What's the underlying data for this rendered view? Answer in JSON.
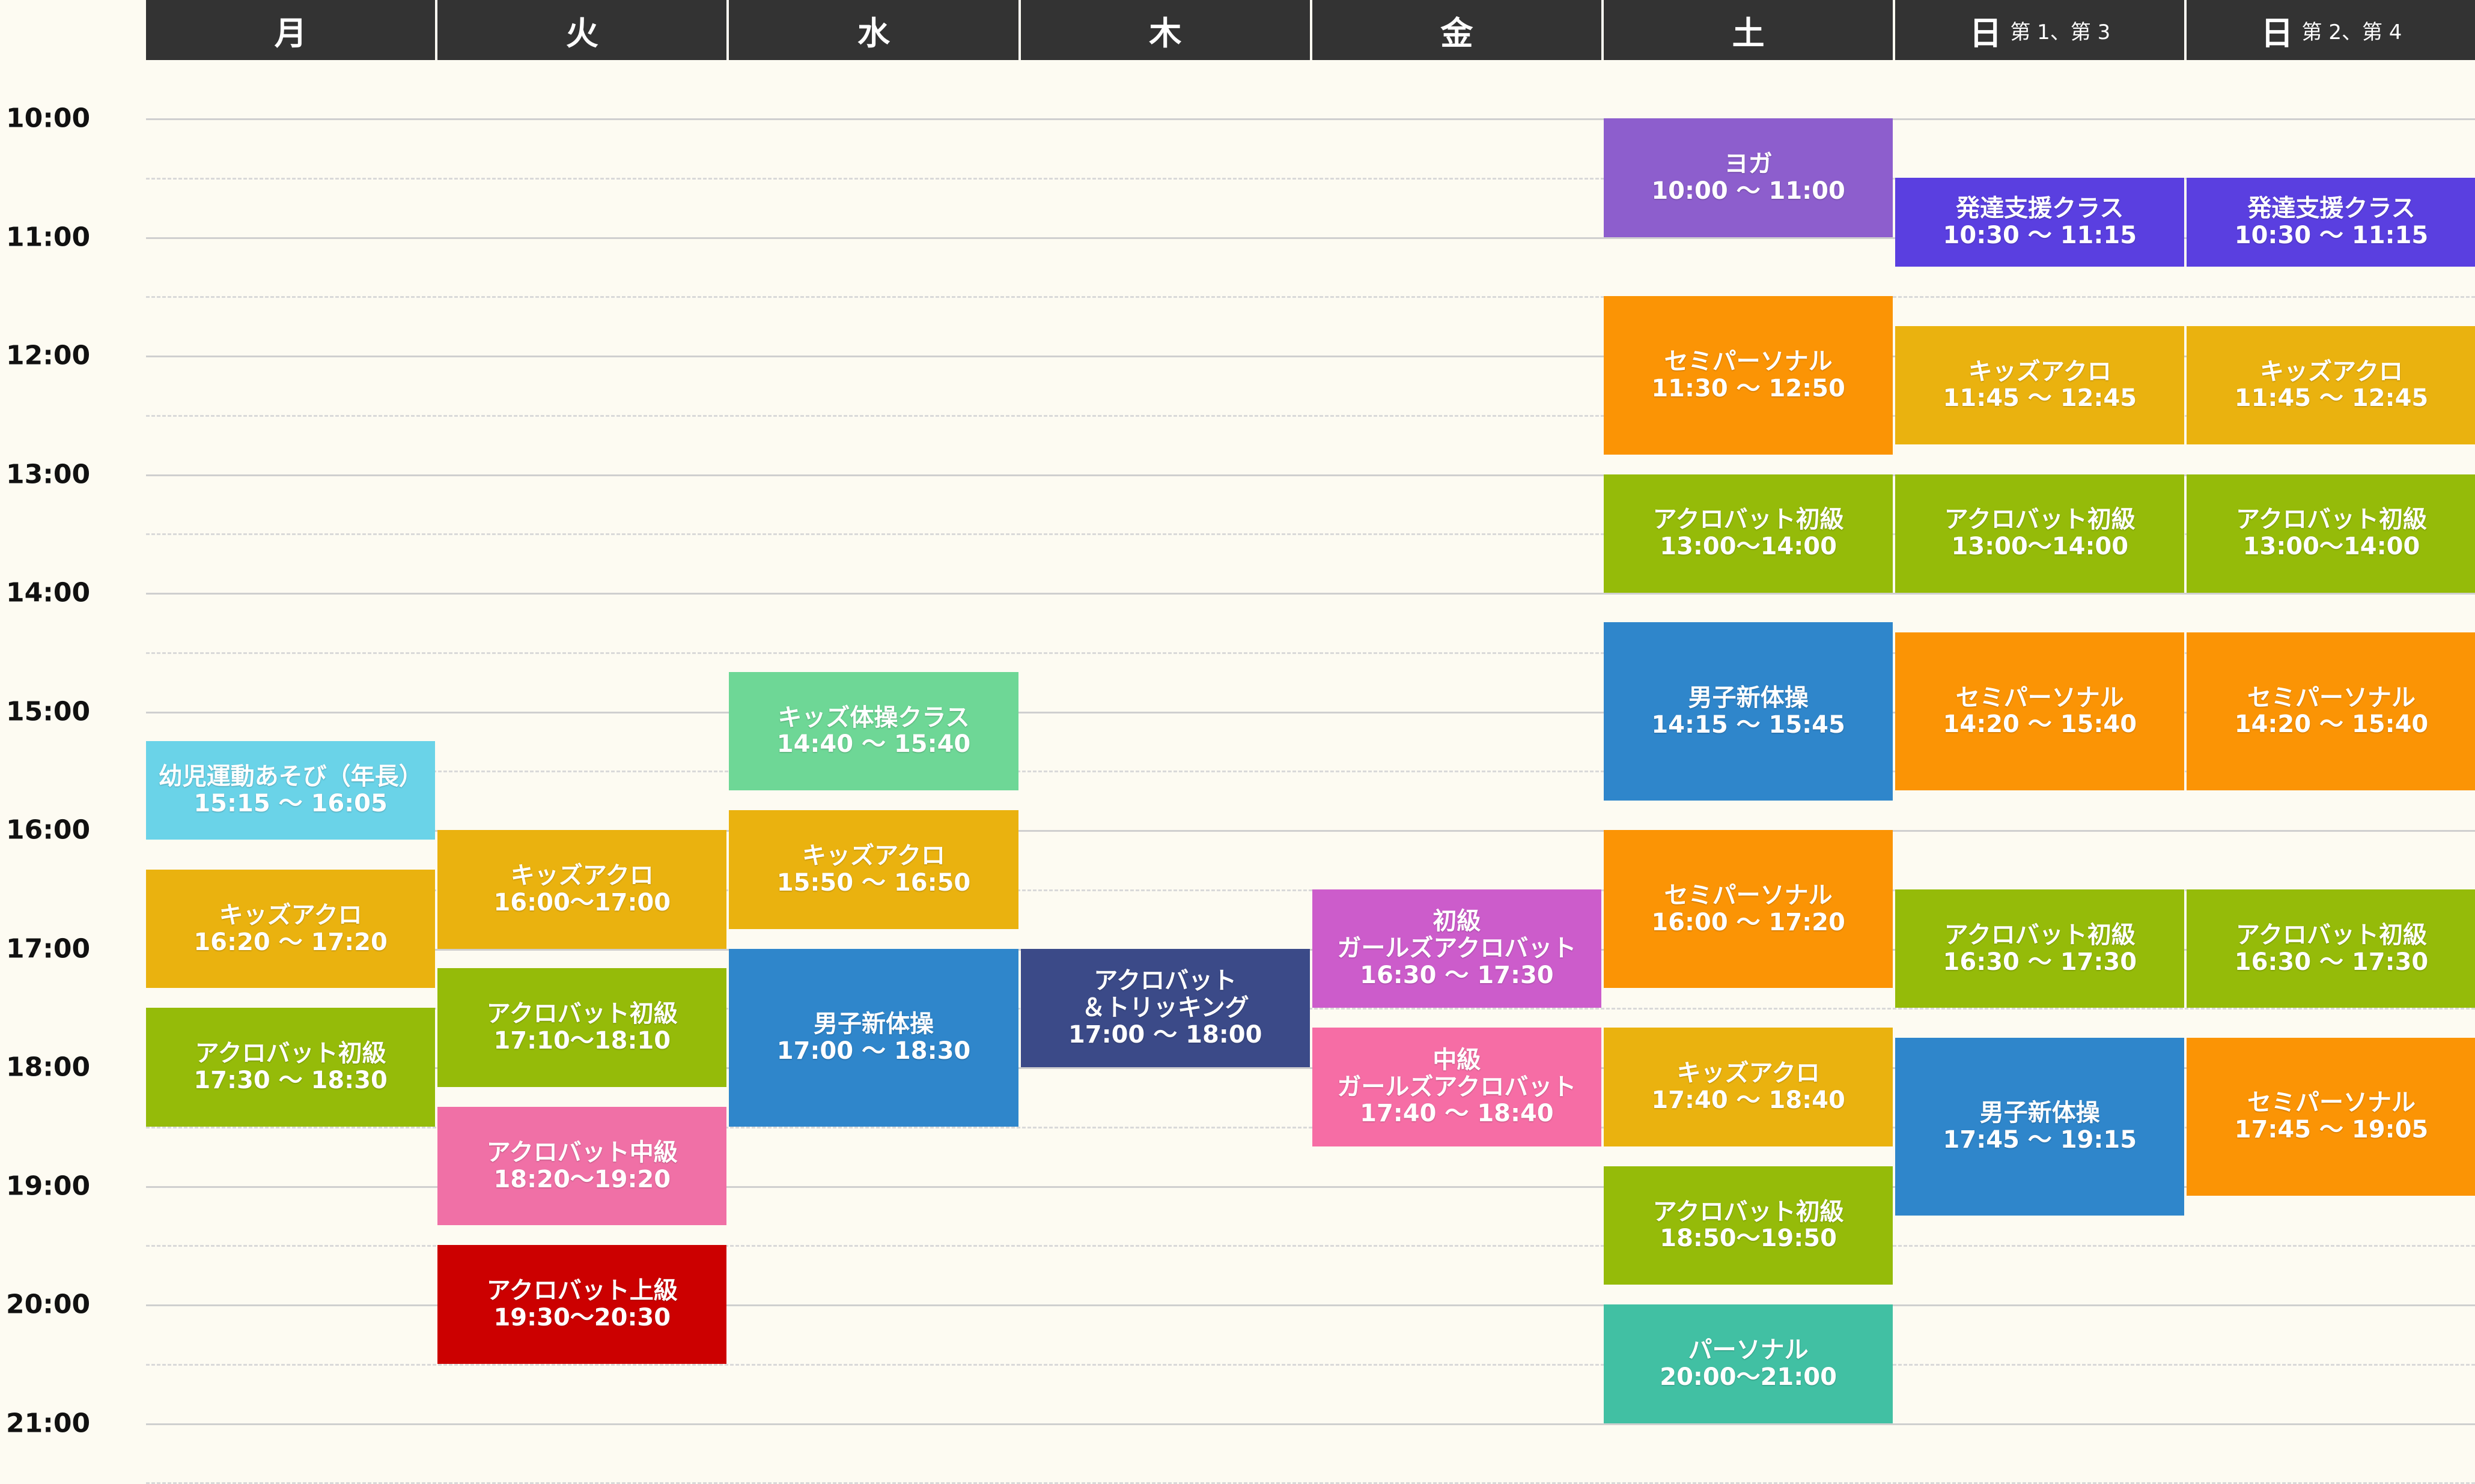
{
  "days": [
    {
      "id": "mon",
      "label": "月",
      "sub": ""
    },
    {
      "id": "tue",
      "label": "火",
      "sub": ""
    },
    {
      "id": "wed",
      "label": "水",
      "sub": ""
    },
    {
      "id": "thu",
      "label": "木",
      "sub": ""
    },
    {
      "id": "fri",
      "label": "金",
      "sub": ""
    },
    {
      "id": "sat",
      "label": "土",
      "sub": ""
    },
    {
      "id": "sun13",
      "label": "日",
      "sub": "第 1、第 3"
    },
    {
      "id": "sun24",
      "label": "日",
      "sub": "第 2、第 4"
    }
  ],
  "time_labels": [
    "10:00",
    "11:00",
    "12:00",
    "13:00",
    "14:00",
    "15:00",
    "16:00",
    "17:00",
    "18:00",
    "19:00",
    "20:00",
    "21:00"
  ],
  "colors": {
    "header_bg": "#333333",
    "page_bg": "#fdfbf2",
    "yellow": "#eab20f",
    "green": "#95bb09",
    "orange": "#fb9405",
    "blue": "#2f86cb",
    "cyan": "#6ad3e8",
    "mint": "#6ed796",
    "purple": "#8d5ecd",
    "indigo": "#5a3fe0",
    "pink": "#f66da5",
    "magenta": "#cc5ccb",
    "red": "#cc0000",
    "navy": "#3b4a88",
    "teal": "#41c0a3",
    "rose": "#f070a6"
  },
  "sessions": [
    {
      "day": 0,
      "start": "15:15",
      "end": "16:05",
      "color": "cyan",
      "lines": [
        "幼児運動あそび（年長）",
        "15:15 ～ 16:05"
      ]
    },
    {
      "day": 0,
      "start": "16:20",
      "end": "17:20",
      "color": "yellow",
      "lines": [
        "キッズアクロ",
        "16:20 ～ 17:20"
      ]
    },
    {
      "day": 0,
      "start": "17:30",
      "end": "18:30",
      "color": "green",
      "lines": [
        "アクロバット初級",
        "17:30 ～ 18:30"
      ]
    },
    {
      "day": 1,
      "start": "16:00",
      "end": "17:00",
      "color": "yellow",
      "lines": [
        "キッズアクロ",
        "16:00～17:00"
      ]
    },
    {
      "day": 1,
      "start": "17:10",
      "end": "18:10",
      "color": "green",
      "lines": [
        "アクロバット初級",
        "17:10～18:10"
      ]
    },
    {
      "day": 1,
      "start": "18:20",
      "end": "19:20",
      "color": "rose",
      "lines": [
        "アクロバット中級",
        "18:20～19:20"
      ]
    },
    {
      "day": 1,
      "start": "19:30",
      "end": "20:30",
      "color": "red",
      "lines": [
        "アクロバット上級",
        "19:30～20:30"
      ]
    },
    {
      "day": 2,
      "start": "14:40",
      "end": "15:40",
      "color": "mint",
      "lines": [
        "キッズ体操クラス",
        "14:40 ～ 15:40"
      ]
    },
    {
      "day": 2,
      "start": "15:50",
      "end": "16:50",
      "color": "yellow",
      "lines": [
        "キッズアクロ",
        "15:50 ～ 16:50"
      ]
    },
    {
      "day": 2,
      "start": "17:00",
      "end": "18:30",
      "color": "blue",
      "lines": [
        "男子新体操",
        "17:00 ～ 18:30"
      ]
    },
    {
      "day": 3,
      "start": "17:00",
      "end": "18:00",
      "color": "navy",
      "lines": [
        "アクロバット",
        "＆トリッキング",
        "17:00 ～ 18:00"
      ]
    },
    {
      "day": 4,
      "start": "16:30",
      "end": "17:30",
      "color": "magenta",
      "lines": [
        "初級",
        "ガールズアクロバット",
        "16:30 ～ 17:30"
      ]
    },
    {
      "day": 4,
      "start": "17:40",
      "end": "18:40",
      "color": "pink",
      "lines": [
        "中級",
        "ガールズアクロバット",
        "17:40 ～ 18:40"
      ]
    },
    {
      "day": 5,
      "start": "10:00",
      "end": "11:00",
      "color": "purple",
      "lines": [
        "ヨガ",
        "10:00 ～ 11:00"
      ]
    },
    {
      "day": 5,
      "start": "11:30",
      "end": "12:50",
      "color": "orange",
      "lines": [
        "セミパーソナル",
        "11:30 ～ 12:50"
      ]
    },
    {
      "day": 5,
      "start": "13:00",
      "end": "14:00",
      "color": "green",
      "lines": [
        "アクロバット初級",
        "13:00～14:00"
      ]
    },
    {
      "day": 5,
      "start": "14:15",
      "end": "15:45",
      "color": "blue",
      "lines": [
        "男子新体操",
        "14:15 ～ 15:45"
      ]
    },
    {
      "day": 5,
      "start": "16:00",
      "end": "17:20",
      "color": "orange",
      "lines": [
        "セミパーソナル",
        "16:00 ～ 17:20"
      ]
    },
    {
      "day": 5,
      "start": "17:40",
      "end": "18:40",
      "color": "yellow",
      "lines": [
        "キッズアクロ",
        "17:40 ～ 18:40"
      ]
    },
    {
      "day": 5,
      "start": "18:50",
      "end": "19:50",
      "color": "green",
      "lines": [
        "アクロバット初級",
        "18:50～19:50"
      ]
    },
    {
      "day": 5,
      "start": "20:00",
      "end": "21:00",
      "color": "teal",
      "lines": [
        "パーソナル",
        "20:00～21:00"
      ]
    },
    {
      "day": 6,
      "start": "10:30",
      "end": "11:15",
      "color": "indigo",
      "lines": [
        "発達支援クラス",
        "10:30 ～ 11:15"
      ]
    },
    {
      "day": 6,
      "start": "11:45",
      "end": "12:45",
      "color": "yellow",
      "lines": [
        "キッズアクロ",
        "11:45 ～ 12:45"
      ]
    },
    {
      "day": 6,
      "start": "13:00",
      "end": "14:00",
      "color": "green",
      "lines": [
        "アクロバット初級",
        "13:00～14:00"
      ]
    },
    {
      "day": 6,
      "start": "14:20",
      "end": "15:40",
      "color": "orange",
      "lines": [
        "セミパーソナル",
        "14:20 ～ 15:40"
      ]
    },
    {
      "day": 6,
      "start": "16:30",
      "end": "17:30",
      "color": "green",
      "lines": [
        "アクロバット初級",
        "16:30 ～ 17:30"
      ]
    },
    {
      "day": 6,
      "start": "17:45",
      "end": "19:15",
      "color": "blue",
      "lines": [
        "男子新体操",
        "17:45 ～ 19:15"
      ]
    },
    {
      "day": 7,
      "start": "10:30",
      "end": "11:15",
      "color": "indigo",
      "lines": [
        "発達支援クラス",
        "10:30 ～ 11:15"
      ]
    },
    {
      "day": 7,
      "start": "11:45",
      "end": "12:45",
      "color": "yellow",
      "lines": [
        "キッズアクロ",
        "11:45 ～ 12:45"
      ]
    },
    {
      "day": 7,
      "start": "13:00",
      "end": "14:00",
      "color": "green",
      "lines": [
        "アクロバット初級",
        "13:00～14:00"
      ]
    },
    {
      "day": 7,
      "start": "14:20",
      "end": "15:40",
      "color": "orange",
      "lines": [
        "セミパーソナル",
        "14:20 ～ 15:40"
      ]
    },
    {
      "day": 7,
      "start": "16:30",
      "end": "17:30",
      "color": "green",
      "lines": [
        "アクロバット初級",
        "16:30 ～ 17:30"
      ]
    },
    {
      "day": 7,
      "start": "17:45",
      "end": "19:05",
      "color": "orange",
      "lines": [
        "セミパーソナル",
        "17:45 ～ 19:05"
      ]
    }
  ]
}
